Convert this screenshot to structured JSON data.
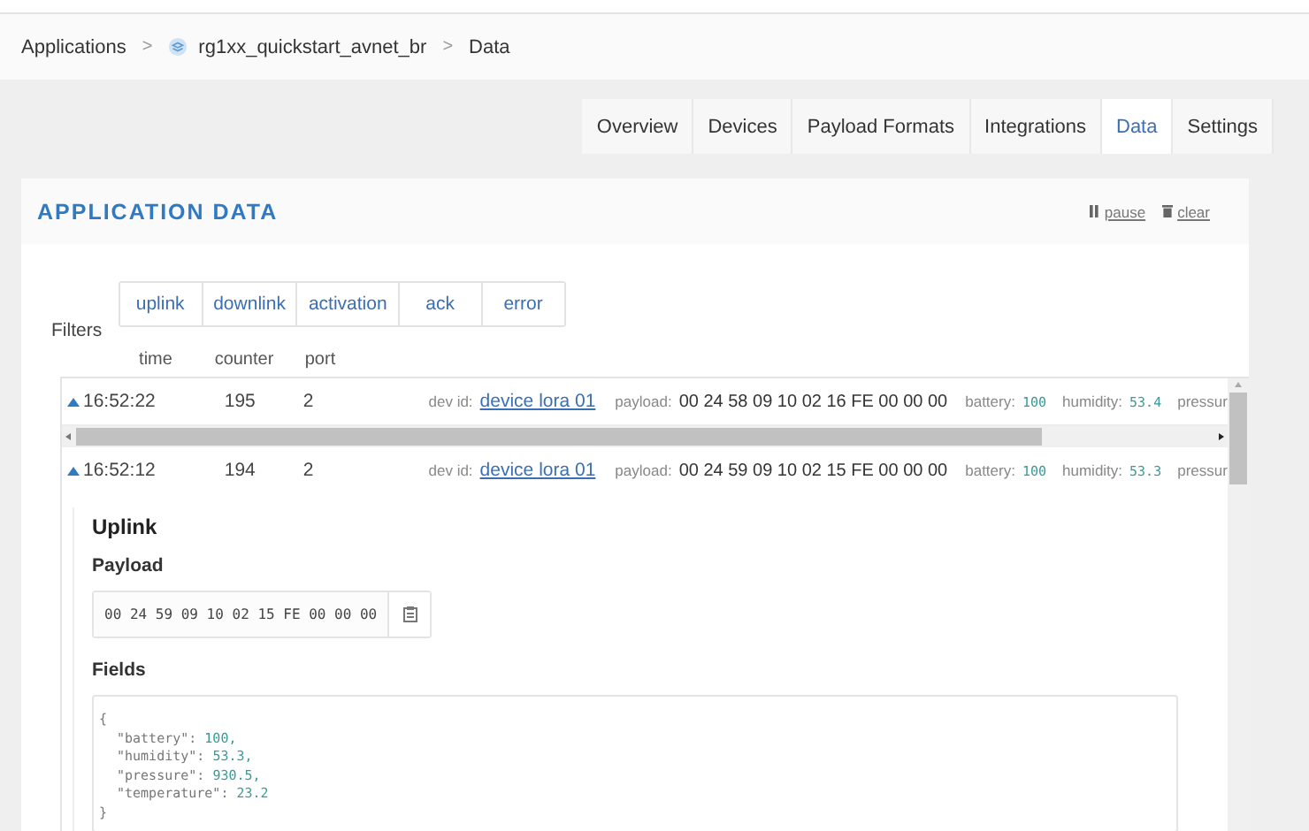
{
  "breadcrumb": {
    "items": [
      {
        "label": "Applications",
        "kind": "link"
      },
      {
        "label": "rg1xx_quickstart_avnet_br",
        "kind": "app"
      },
      {
        "label": "Data",
        "kind": "current"
      }
    ],
    "separator": ">"
  },
  "tabs": [
    {
      "label": "Overview",
      "selected": false
    },
    {
      "label": "Devices",
      "selected": false
    },
    {
      "label": "Payload Formats",
      "selected": false
    },
    {
      "label": "Integrations",
      "selected": false
    },
    {
      "label": "Data",
      "selected": true
    },
    {
      "label": "Settings",
      "selected": false
    }
  ],
  "panel": {
    "title": "APPLICATION DATA",
    "actions": [
      {
        "label": "pause",
        "kind": "pause"
      },
      {
        "label": "clear",
        "kind": "clear"
      }
    ]
  },
  "filters": {
    "label": "Filters",
    "options": [
      "uplink",
      "downlink",
      "activation",
      "ack",
      "error"
    ]
  },
  "columns": [
    "time",
    "counter",
    "port"
  ],
  "rows": [
    {
      "time": "16:52:22",
      "counter": "195",
      "port": "2",
      "dev_id_label": "dev id:",
      "dev_id": "device lora 01",
      "payload_label": "payload:",
      "payload": "00 24 58 09 10 02 16 FE 00 00 00",
      "fields": [
        {
          "name": "battery:",
          "value": "100"
        },
        {
          "name": "humidity:",
          "value": "53.4"
        },
        {
          "name": "pressur"
        }
      ],
      "expanded": false
    },
    {
      "time": "16:52:12",
      "counter": "194",
      "port": "2",
      "dev_id_label": "dev id:",
      "dev_id": "device lora 01",
      "payload_label": "payload:",
      "payload": "00 24 59 09 10 02 15 FE 00 00 00",
      "fields": [
        {
          "name": "battery:",
          "value": "100"
        },
        {
          "name": "humidity:",
          "value": "53.3"
        },
        {
          "name": "pressur"
        }
      ],
      "expanded": true
    }
  ],
  "detail": {
    "title": "Uplink",
    "payload_label": "Payload",
    "payload": "00 24 59 09 10 02 15 FE 00 00 00",
    "fields_label": "Fields",
    "json_lines": [
      {
        "kind": "brace",
        "text": "{"
      },
      {
        "kind": "pair",
        "key": "\"battery\":",
        "value": "100,"
      },
      {
        "kind": "pair",
        "key": "\"humidity\":",
        "value": "53.3,"
      },
      {
        "kind": "pair",
        "key": "\"pressure\":",
        "value": "930.5,"
      },
      {
        "kind": "pair",
        "key": "\"temperature\":",
        "value": "23.2"
      },
      {
        "kind": "brace",
        "text": "}"
      }
    ]
  }
}
